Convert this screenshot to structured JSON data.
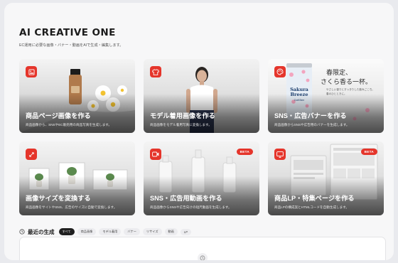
{
  "app": {
    "title": "AI CREATIVE ONE",
    "subtitle": "EC運用に必要な画像・バナー・動画をAIで生成・編集します。"
  },
  "cards": [
    {
      "title": "商品ページ画像を作る",
      "desc": "商品画像から、SNSやEC販売用の商品写真を生成します。",
      "icon": "image-icon"
    },
    {
      "title": "モデル着用画像を作る",
      "desc": "商品画像をモデル着用写真に変換します。",
      "icon": "shirt-icon"
    },
    {
      "title": "SNS・広告バナーを作る",
      "desc": "商品画像からSNSや広告用のバナーを生成します。",
      "icon": "palette-icon",
      "banner": {
        "can_text": "Sakura Breeze",
        "can_sub": "Craft Beer",
        "headline_1": "春限定、",
        "headline_2": "さくら香る一杯。",
        "copy_1": "やさしい香りとすっきりした飲みごこち。",
        "copy_2": "春のひとときに。"
      }
    },
    {
      "title": "画像サイズを変換する",
      "desc": "商品画像をサイトやSNS、広告のサイズに自動で変換します。",
      "icon": "resize-icon"
    },
    {
      "title": "SNS・広告用動画を作る",
      "desc": "商品画像からSNSや広告向けの短尺動画を生成します。",
      "icon": "video-icon",
      "badge": "BETA"
    },
    {
      "title": "商品LP・特集ページを作る",
      "desc": "商品LPの構成案とHTMLコードを自動生成します。",
      "icon": "monitor-icon",
      "badge": "BETA"
    }
  ],
  "recent": {
    "heading": "最近の生成",
    "filters": [
      "すべて",
      "商品画像",
      "モデル着用",
      "バナー",
      "リサイズ",
      "動画",
      "LP"
    ],
    "active_filter": "すべて"
  },
  "colors": {
    "accent": "#e5352b",
    "background": "#f7f7f8"
  }
}
